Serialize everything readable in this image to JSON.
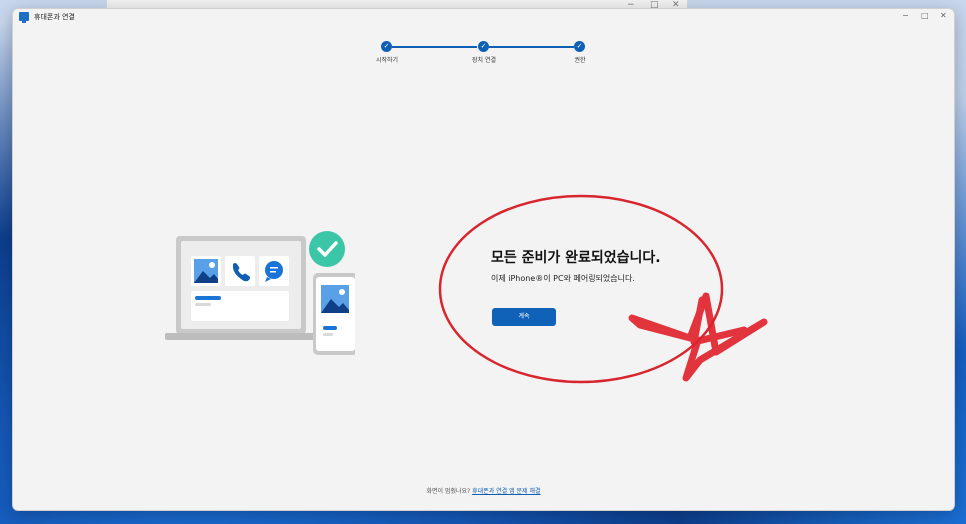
{
  "window": {
    "title": "휴대폰과 연결",
    "controls": {
      "minimize": "−",
      "maximize": "□",
      "close": "✕"
    }
  },
  "background_window": {
    "controls": {
      "minimize": "−",
      "maximize": "□",
      "close": "✕"
    }
  },
  "stepper": {
    "steps": [
      {
        "label": "시작하기",
        "icon": "check-icon",
        "completed": true
      },
      {
        "label": "장치 연결",
        "icon": "check-icon",
        "completed": true
      },
      {
        "label": "권한",
        "icon": "check-icon",
        "completed": true
      }
    ],
    "accent": "#0f5fb5"
  },
  "main": {
    "title": "모든 준비가 완료되었습니다.",
    "subtitle": "이제 iPhone®이 PC와 페어링되었습니다.",
    "continue_label": "계속"
  },
  "footer": {
    "prompt": "화면이 멈췄나요?",
    "link": "휴대폰과 연결 앱 문제 해결"
  },
  "illustration": {
    "icons": [
      "image-icon",
      "phone-call-icon",
      "chat-icon",
      "checkmark-badge-icon"
    ],
    "colors": {
      "accent": "#0f5fb5",
      "badge": "#3cc6a8",
      "annotation": "#e0202a"
    }
  }
}
